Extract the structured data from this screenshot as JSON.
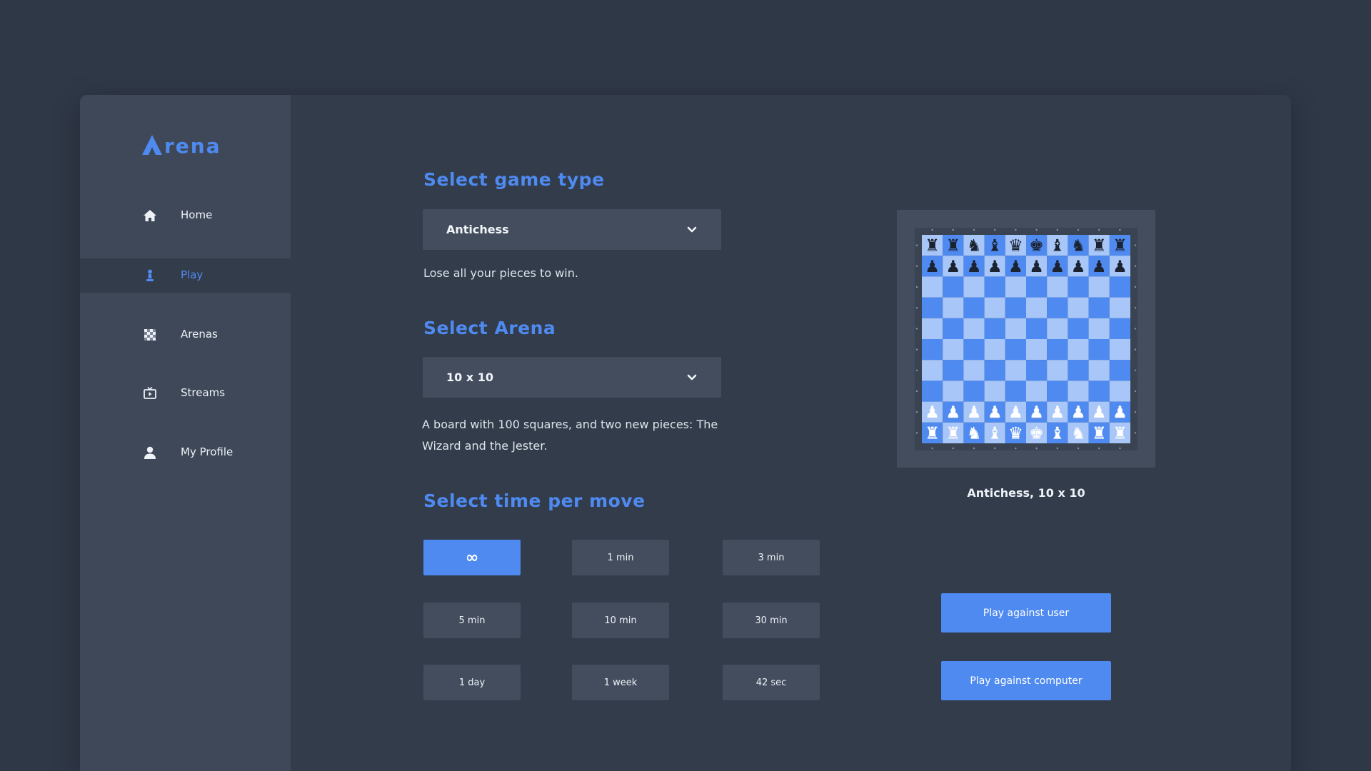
{
  "app": {
    "logo_text": "rena"
  },
  "sidebar": {
    "items": [
      {
        "label": "Home",
        "icon": "home-icon"
      },
      {
        "label": "Play",
        "icon": "pawn-icon",
        "active": true
      },
      {
        "label": "Arenas",
        "icon": "checker-icon"
      },
      {
        "label": "Streams",
        "icon": "tv-icon"
      },
      {
        "label": "My Profile",
        "icon": "user-icon"
      }
    ]
  },
  "game_type": {
    "heading": "Select game type",
    "selected": "Antichess",
    "description": "Lose all your pieces to win."
  },
  "arena": {
    "heading": "Select Arena",
    "selected": "10 x 10",
    "description_line1": "A board with 100 squares, and two new pieces: The",
    "description_line2": "Wizard and the Jester."
  },
  "time": {
    "heading": "Select time per move",
    "options": [
      "∞",
      "1 min",
      "3 min",
      "5 min",
      "10 min",
      "30 min",
      "1 day",
      "1 week",
      "42 sec"
    ],
    "selected_index": 0
  },
  "preview": {
    "caption": "Antichess, 10 x 10",
    "board_rows": 10,
    "board_cols": 10,
    "black_back_rank": [
      "♜",
      "♜",
      "♞",
      "♝",
      "♛",
      "♚",
      "♝",
      "♞",
      "♜",
      "♜"
    ],
    "black_pawn": "♟",
    "white_back_rank": [
      "♖",
      "♖",
      "♘",
      "♗",
      "♕",
      "♔",
      "♗",
      "♘",
      "♖",
      "♖"
    ],
    "white_pawn": "♙"
  },
  "actions": {
    "play_user": "Play against user",
    "play_computer": "Play against computer"
  },
  "colors": {
    "accent": "#4f8af0",
    "light_square": "#a8c6f7",
    "dark_square": "#4f8af0",
    "background": "#2f3847"
  }
}
